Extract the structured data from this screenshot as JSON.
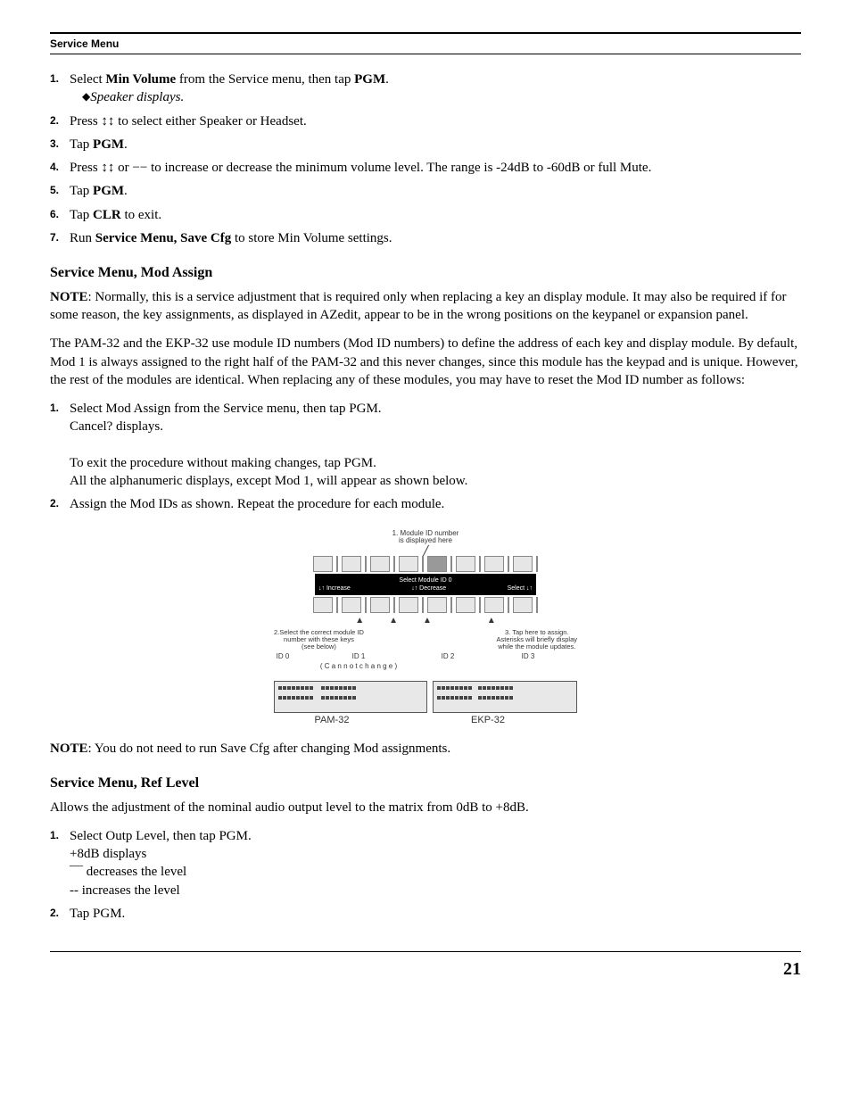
{
  "header": {
    "title": "Service Menu"
  },
  "steps1": [
    {
      "num": "1.",
      "parts": [
        "Select ",
        "Min Volume",
        " from the Service menu, then tap ",
        "PGM",
        "."
      ],
      "sub": [
        "◆",
        "Speaker displays."
      ]
    },
    {
      "num": "2.",
      "parts": [
        "Press ",
        "↕↕",
        " to select either Speaker or Headset."
      ]
    },
    {
      "num": "3.",
      "parts": [
        "Tap ",
        "PGM",
        "."
      ]
    },
    {
      "num": "4.",
      "parts": [
        "Press ",
        "↕↕",
        " or ",
        "−−",
        " to increase or decrease the minimum volume level. The range is -24dB to -60dB or full Mute."
      ]
    },
    {
      "num": "5.",
      "parts": [
        "Tap ",
        "PGM",
        "."
      ]
    },
    {
      "num": "6.",
      "parts": [
        "Tap ",
        "CLR",
        " to exit."
      ]
    },
    {
      "num": "7.",
      "parts": [
        "Run ",
        "Service Menu, Save Cfg",
        " to store Min Volume settings."
      ]
    }
  ],
  "section_mod": {
    "title": "Service Menu, Mod Assign",
    "note_label": "NOTE",
    "note_text": ": Normally, this is a service adjustment that is required only when replacing a key an display module. It may also be required if for some reason, the key assignments, as displayed in AZedit, appear to be in the wrong positions on the keypanel or expansion panel.",
    "body": "The PAM-32 and the EKP-32 use module ID numbers (Mod ID numbers) to define the address of each key and display module. By default, Mod 1 is always assigned to the right half of the PAM-32 and this never changes, since this module has the keypad and is unique. However, the rest of the modules are identical. When replacing any of these modules, you may have to reset the Mod ID number as follows:"
  },
  "steps2": [
    {
      "num": "1.",
      "text": "Select Mod Assign from the Service menu, then tap PGM.",
      "sub1": "Cancel? displays.",
      "sub2": "To exit the procedure without making changes, tap PGM.",
      "sub3": "All the alphanumeric displays, except Mod 1, will appear as shown below."
    },
    {
      "num": "2.",
      "text": "Assign the Mod IDs as shown. Repeat the procedure for each module."
    }
  ],
  "figure": {
    "note_top": "1. Module ID number\nis displayed here",
    "infobar_top": "Select Module ID 0",
    "infobar_left": "↓↑ Increase",
    "infobar_mid": "↓↑ Decrease",
    "infobar_right": "Select ↓↑",
    "annot_left": "2.Select the correct module ID\nnumber with these keys\n(see below)",
    "annot_right": "3. Tap here to assign.\nAsterisks will briefly display\nwhile the module updates.",
    "id0": "ID 0",
    "id1": "ID   1",
    "id1_sub": "( C a n n o t   c h a n g e )",
    "id2": "ID   2",
    "id3": "ID   3",
    "pam_label": "PAM-32",
    "ekp_label": "EKP-32"
  },
  "note2_label": "NOTE",
  "note2_text": ": You do not need to run Save Cfg after changing Mod assignments.",
  "section_ref": {
    "title": "Service Menu, Ref Level",
    "body": "Allows the adjustment of the nominal audio output level to the matrix from 0dB to +8dB."
  },
  "steps3": [
    {
      "num": "1.",
      "text": "Select Outp Level, then tap PGM.",
      "sub1": "+8dB displays",
      "sub2": "¯¯ decreases the level",
      "sub3": "-- increases the level"
    },
    {
      "num": "2.",
      "text": "Tap PGM."
    }
  ],
  "page_number": "21"
}
